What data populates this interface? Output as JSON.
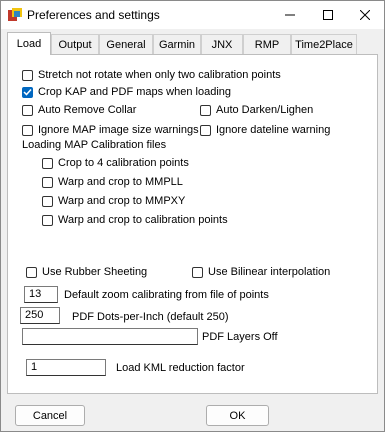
{
  "window": {
    "title": "Preferences and settings"
  },
  "tabs": [
    "Load",
    "Output",
    "General",
    "Garmin",
    "JNX",
    "RMP",
    "Time2Place"
  ],
  "load": {
    "stretch_label": "Stretch not rotate when only two calibration points",
    "crop_kap_label": "Crop KAP and PDF maps when loading",
    "auto_remove_collar_label": "Auto Remove Collar",
    "auto_darken_label": "Auto Darken/Lighen",
    "ignore_map_size_label": "Ignore MAP image size warnings",
    "ignore_dateline_label": "Ignore dateline warning",
    "calibration_group_label": "Loading MAP Calibration files",
    "crop4_label": "Crop to 4 calibration points",
    "warp_mmpll_label": "Warp and crop to MMPLL",
    "warp_mmpxy_label": "Warp and crop to MMPXY",
    "warp_calib_label": "Warp and crop to calibration points",
    "rubber_sheeting_label": "Use Rubber Sheeting",
    "bilinear_label": "Use Bilinear interpolation",
    "zoom_value": "13",
    "zoom_label": "Default zoom calibrating from file of points",
    "pdf_dpi_value": "250",
    "pdf_dpi_label": "PDF Dots-per-Inch (default 250)",
    "pdf_layers_value": "",
    "pdf_layers_label": "PDF Layers Off",
    "kml_value": "1",
    "kml_label": "Load KML reduction factor"
  },
  "buttons": {
    "cancel": "Cancel",
    "ok": "OK"
  },
  "colors": {
    "accent": "#0067c0"
  }
}
